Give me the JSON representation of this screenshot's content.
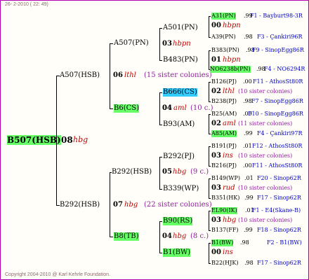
{
  "header": "26- 2-2010 ( 22: 49)",
  "footer": "Copyright 2004-2010 @ Karl Kehrle Foundation.",
  "root": {
    "label": "B507(HSB)",
    "num": "08",
    "code": "hbg"
  },
  "g1": {
    "top": {
      "label": "A507(HSB)",
      "num": "06",
      "code": "lthl",
      "sisters": "(15 sister colonies)"
    },
    "bot": {
      "label": "B292(HSB)",
      "num": "07",
      "code": "hbg",
      "sisters": "(22 sister colonies)"
    }
  },
  "g2": {
    "a507pn": {
      "label": "A507(PN)"
    },
    "b6cs": {
      "label": "B6(CS)",
      "num": "04",
      "code": "aml",
      "sisters": "(10 c.)"
    },
    "b292hsb": {
      "label": "B292(HSB)",
      "num": "05",
      "code": "hbg",
      "sisters": "(9 c.)"
    },
    "b8tb": {
      "label": "B8(TB)",
      "num": "04",
      "code": "hbg",
      "sisters": "(8 c.)"
    }
  },
  "g3": {
    "a501pn": {
      "label": "A501(PN)",
      "num": "03",
      "code": "hbpn"
    },
    "b483pn": {
      "label": "B483(PN)"
    },
    "b666cs": {
      "label": "B666(CS)",
      "num": "02",
      "code": "lthl",
      "sisters": "(10 sister colonies)"
    },
    "b93am": {
      "label": "B93(AM)",
      "num": "02",
      "code": "aml",
      "sisters": "(11 sister colonies)"
    },
    "b292pj": {
      "label": "B292(PJ)",
      "num": "03",
      "code": "ins",
      "sisters": "(10 sister colonies)"
    },
    "b339wp": {
      "label": "B339(WP)",
      "num": "03",
      "code": "rud",
      "sisters": "(10 sister colonies)"
    },
    "b90rs": {
      "label": "B90(RS)",
      "num": "03",
      "code": "hbg",
      "sisters": "(10 sister colonies)"
    },
    "b1bw": {
      "label": "B1(BW)",
      "num": "00",
      "code": "ins"
    }
  },
  "g4": [
    {
      "label": "A31(PN)",
      "val": ".99",
      "right": "F1 - Bayburt98-3R"
    },
    {
      "num": "00",
      "code": "hbpn"
    },
    {
      "label": "A39(PN)",
      "val": ".98",
      "right": "F3 - Çankiri96R"
    },
    {
      "label": "B383(PN)",
      "val": ".98",
      "right": "F9 - SinopEgg86R"
    },
    {
      "num": "01",
      "code": "hbpn"
    },
    {
      "label": "NO6238b(PN)",
      "val": ".98",
      "right": "F4 - NO6294R"
    },
    {
      "label": "B126(PJ)",
      "val": ".00",
      "right": "F11 - AthosSt80R"
    },
    {
      "label": "B238(PJ)",
      "val": ".98",
      "right": "F7 - SinopEgg86R"
    },
    {
      "label": "B25(AM)",
      "val": ".00",
      "right": "F10 - SinopEgg86R"
    },
    {
      "label": "A85(AM)",
      "val": ".99",
      "right": "F4 - Çankiri97R"
    },
    {
      "label": "B191(PJ)",
      "val": ".01",
      "right": "F12 - AthosSt80R"
    },
    {
      "label": "B216(PJ)",
      "val": ".00",
      "right": "F11 - AthosSt80R"
    },
    {
      "label": "B149(WP)",
      "val": ".01",
      "right": "F20 - Sinop62R"
    },
    {
      "label": "B351(HK)",
      "val": ".99",
      "right": "F17 - Sinop62R"
    },
    {
      "label": "EL90(IK)",
      "val": ".01",
      "right": "F1 - E4(Skane-B)"
    },
    {
      "label": "B137(FF)",
      "val": ".99",
      "right": "F18 - Sinop62R"
    },
    {
      "label": "B1(BW)",
      "val": ".98",
      "right": "F2 - B1(BW)"
    },
    {
      "label": "B22(HJK)",
      "val": ".98",
      "right": "F17 - Sinop62R"
    }
  ],
  "colors": {
    "green": "#66ff66",
    "cyan": "#33ccff",
    "code": "#c00000",
    "right": "#0000c0",
    "sister": "#9020a0",
    "frame": "#b000b0"
  }
}
